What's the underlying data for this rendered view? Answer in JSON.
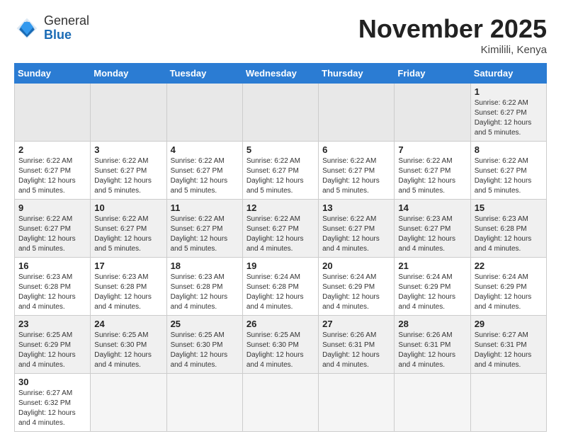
{
  "header": {
    "logo_general": "General",
    "logo_blue": "Blue",
    "month_title": "November 2025",
    "location": "Kimilili, Kenya"
  },
  "weekdays": [
    "Sunday",
    "Monday",
    "Tuesday",
    "Wednesday",
    "Thursday",
    "Friday",
    "Saturday"
  ],
  "weeks": [
    [
      {
        "day": null,
        "info": null
      },
      {
        "day": null,
        "info": null
      },
      {
        "day": null,
        "info": null
      },
      {
        "day": null,
        "info": null
      },
      {
        "day": null,
        "info": null
      },
      {
        "day": null,
        "info": null
      },
      {
        "day": "1",
        "info": "Sunrise: 6:22 AM\nSunset: 6:27 PM\nDaylight: 12 hours\nand 5 minutes."
      }
    ],
    [
      {
        "day": "2",
        "info": "Sunrise: 6:22 AM\nSunset: 6:27 PM\nDaylight: 12 hours\nand 5 minutes."
      },
      {
        "day": "3",
        "info": "Sunrise: 6:22 AM\nSunset: 6:27 PM\nDaylight: 12 hours\nand 5 minutes."
      },
      {
        "day": "4",
        "info": "Sunrise: 6:22 AM\nSunset: 6:27 PM\nDaylight: 12 hours\nand 5 minutes."
      },
      {
        "day": "5",
        "info": "Sunrise: 6:22 AM\nSunset: 6:27 PM\nDaylight: 12 hours\nand 5 minutes."
      },
      {
        "day": "6",
        "info": "Sunrise: 6:22 AM\nSunset: 6:27 PM\nDaylight: 12 hours\nand 5 minutes."
      },
      {
        "day": "7",
        "info": "Sunrise: 6:22 AM\nSunset: 6:27 PM\nDaylight: 12 hours\nand 5 minutes."
      },
      {
        "day": "8",
        "info": "Sunrise: 6:22 AM\nSunset: 6:27 PM\nDaylight: 12 hours\nand 5 minutes."
      }
    ],
    [
      {
        "day": "9",
        "info": "Sunrise: 6:22 AM\nSunset: 6:27 PM\nDaylight: 12 hours\nand 5 minutes."
      },
      {
        "day": "10",
        "info": "Sunrise: 6:22 AM\nSunset: 6:27 PM\nDaylight: 12 hours\nand 5 minutes."
      },
      {
        "day": "11",
        "info": "Sunrise: 6:22 AM\nSunset: 6:27 PM\nDaylight: 12 hours\nand 5 minutes."
      },
      {
        "day": "12",
        "info": "Sunrise: 6:22 AM\nSunset: 6:27 PM\nDaylight: 12 hours\nand 4 minutes."
      },
      {
        "day": "13",
        "info": "Sunrise: 6:22 AM\nSunset: 6:27 PM\nDaylight: 12 hours\nand 4 minutes."
      },
      {
        "day": "14",
        "info": "Sunrise: 6:23 AM\nSunset: 6:27 PM\nDaylight: 12 hours\nand 4 minutes."
      },
      {
        "day": "15",
        "info": "Sunrise: 6:23 AM\nSunset: 6:28 PM\nDaylight: 12 hours\nand 4 minutes."
      }
    ],
    [
      {
        "day": "16",
        "info": "Sunrise: 6:23 AM\nSunset: 6:28 PM\nDaylight: 12 hours\nand 4 minutes."
      },
      {
        "day": "17",
        "info": "Sunrise: 6:23 AM\nSunset: 6:28 PM\nDaylight: 12 hours\nand 4 minutes."
      },
      {
        "day": "18",
        "info": "Sunrise: 6:23 AM\nSunset: 6:28 PM\nDaylight: 12 hours\nand 4 minutes."
      },
      {
        "day": "19",
        "info": "Sunrise: 6:24 AM\nSunset: 6:28 PM\nDaylight: 12 hours\nand 4 minutes."
      },
      {
        "day": "20",
        "info": "Sunrise: 6:24 AM\nSunset: 6:29 PM\nDaylight: 12 hours\nand 4 minutes."
      },
      {
        "day": "21",
        "info": "Sunrise: 6:24 AM\nSunset: 6:29 PM\nDaylight: 12 hours\nand 4 minutes."
      },
      {
        "day": "22",
        "info": "Sunrise: 6:24 AM\nSunset: 6:29 PM\nDaylight: 12 hours\nand 4 minutes."
      }
    ],
    [
      {
        "day": "23",
        "info": "Sunrise: 6:25 AM\nSunset: 6:29 PM\nDaylight: 12 hours\nand 4 minutes."
      },
      {
        "day": "24",
        "info": "Sunrise: 6:25 AM\nSunset: 6:30 PM\nDaylight: 12 hours\nand 4 minutes."
      },
      {
        "day": "25",
        "info": "Sunrise: 6:25 AM\nSunset: 6:30 PM\nDaylight: 12 hours\nand 4 minutes."
      },
      {
        "day": "26",
        "info": "Sunrise: 6:25 AM\nSunset: 6:30 PM\nDaylight: 12 hours\nand 4 minutes."
      },
      {
        "day": "27",
        "info": "Sunrise: 6:26 AM\nSunset: 6:31 PM\nDaylight: 12 hours\nand 4 minutes."
      },
      {
        "day": "28",
        "info": "Sunrise: 6:26 AM\nSunset: 6:31 PM\nDaylight: 12 hours\nand 4 minutes."
      },
      {
        "day": "29",
        "info": "Sunrise: 6:27 AM\nSunset: 6:31 PM\nDaylight: 12 hours\nand 4 minutes."
      }
    ],
    [
      {
        "day": "30",
        "info": "Sunrise: 6:27 AM\nSunset: 6:32 PM\nDaylight: 12 hours\nand 4 minutes."
      },
      {
        "day": null,
        "info": null
      },
      {
        "day": null,
        "info": null
      },
      {
        "day": null,
        "info": null
      },
      {
        "day": null,
        "info": null
      },
      {
        "day": null,
        "info": null
      },
      {
        "day": null,
        "info": null
      }
    ]
  ]
}
